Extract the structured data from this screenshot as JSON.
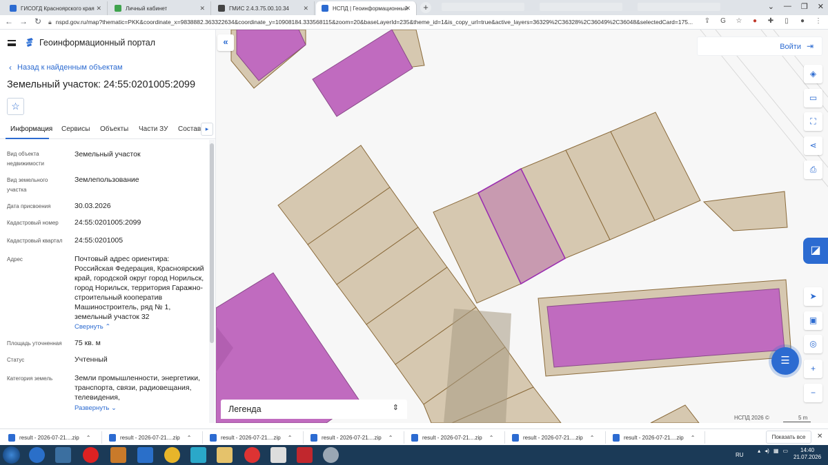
{
  "browser": {
    "tabs": [
      {
        "label": "ГИСОГД Красноярского края",
        "favicon_color": "#2c6bd1"
      },
      {
        "label": "Личный кабинет",
        "favicon_color": "#3fa34d"
      },
      {
        "label": "ГМИС 2.4.3.75.00.10.34",
        "favicon_color": "#444444"
      },
      {
        "label": "НСПД | Геоинформационный п",
        "favicon_color": "#2c6bd1"
      }
    ],
    "url": "nspd.gov.ru/map?thematic=PKK&coordinate_x=9838882.363322634&coordinate_y=10908184.333568115&zoom=20&baseLayerId=235&theme_id=1&is_copy_url=true&active_layers=36329%2C36328%2C36049%2C36048&selectedCard=175..."
  },
  "panel": {
    "portal_title": "Геоинформационный портал",
    "back_link": "Назад к найденным объектам",
    "object_title": "Земельный участок: 24:55:0201005:2099",
    "tabs": [
      "Информация",
      "Сервисы",
      "Объекты",
      "Части ЗУ",
      "Состав"
    ],
    "properties": [
      {
        "label": "Вид объекта недвижимости",
        "value": "Земельный участок"
      },
      {
        "label": "Вид земельного участка",
        "value": "Землепользование"
      },
      {
        "label": "Дата присвоения",
        "value": "30.03.2026"
      },
      {
        "label": "Кадастровый номер",
        "value": "24:55:0201005:2099"
      },
      {
        "label": "Кадастровый квартал",
        "value": "24:55:0201005"
      },
      {
        "label": "Адрес",
        "value": "Почтовый адрес ориентира: Российская Федерация, Красноярский край, городской округ город Норильск, город Норильск, территория Гаражно-строительный кооператив Машиностроитель, ряд № 1, земельный участок 32"
      },
      {
        "label": "Площадь уточненная",
        "value": "75 кв. м"
      },
      {
        "label": "Статус",
        "value": "Учтенный"
      },
      {
        "label": "Категория земель",
        "value": "Земли промышленности, энергетики, транспорта, связи, радиовещания, телевидения,"
      }
    ],
    "collapse_link": "Свернуть",
    "expand_link": "Развернуть"
  },
  "map": {
    "login_label": "Войти",
    "legend_label": "Легенда",
    "attribution": "НСПД 2026 ©",
    "scale_label": "5 m",
    "colors": {
      "background": "#f7f7f7",
      "parcel_fill": "#d6c8b0",
      "parcel_stroke": "#8a6a3a",
      "building_fill": "#c06bbf",
      "selected_fill": "#c89ab0",
      "selected_stroke": "#9b2fb0",
      "accent": "#2c6bd1"
    },
    "tool_icons": [
      "layers-icon",
      "ruler-icon",
      "select-area-icon",
      "share-icon",
      "print-icon",
      "locate-icon",
      "minimap-icon",
      "search-location-icon",
      "zoom-in-icon",
      "zoom-out-icon"
    ]
  },
  "downloads": {
    "items": [
      "result - 2026-07-21....zip",
      "result - 2026-07-21....zip",
      "result - 2026-07-21....zip",
      "result - 2026-07-21....zip",
      "result - 2026-07-21....zip",
      "result - 2026-07-21....zip",
      "result - 2026-07-21....zip"
    ],
    "show_all": "Показать все"
  },
  "taskbar": {
    "language": "RU",
    "time": "14:40",
    "date": "21.07.2026"
  }
}
